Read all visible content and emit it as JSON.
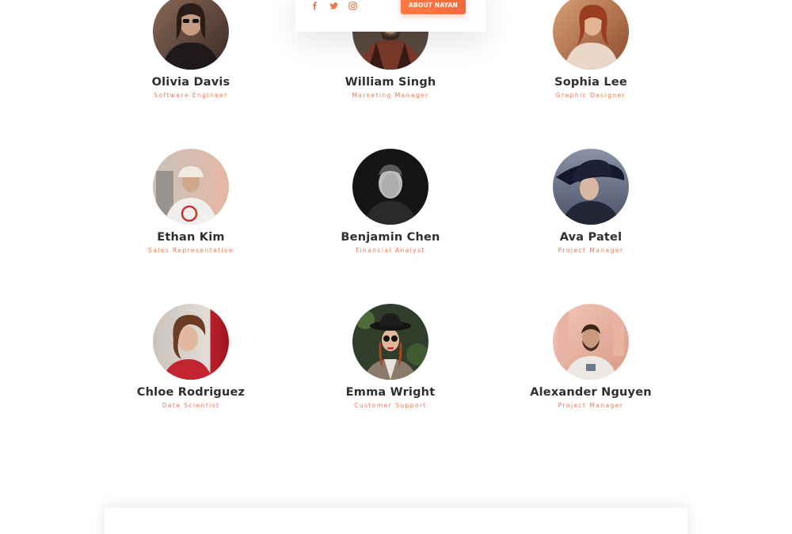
{
  "popup": {
    "social_icons": [
      "facebook-icon",
      "twitter-icon",
      "instagram-icon"
    ],
    "about_button_label": "ABOUT NAYAN"
  },
  "team": {
    "members": [
      {
        "name": "Olivia Davis",
        "role": "Software Engineer"
      },
      {
        "name": "William Singh",
        "role": "Marketing Manager"
      },
      {
        "name": "Sophia Lee",
        "role": "Graphic Designer"
      },
      {
        "name": "Ethan Kim",
        "role": "Sales Representative"
      },
      {
        "name": "Benjamin Chen",
        "role": "Financial Analyst"
      },
      {
        "name": "Ava Patel",
        "role": "Project Manager"
      },
      {
        "name": "Chloe Rodriguez",
        "role": "Data Scientist"
      },
      {
        "name": "Emma Wright",
        "role": "Customer Support"
      },
      {
        "name": "Alexander Nguyen",
        "role": "Project Manager"
      }
    ]
  },
  "colors": {
    "accent": "#f0764a",
    "button": "#f26a3e",
    "name_text": "#2f2f33"
  }
}
